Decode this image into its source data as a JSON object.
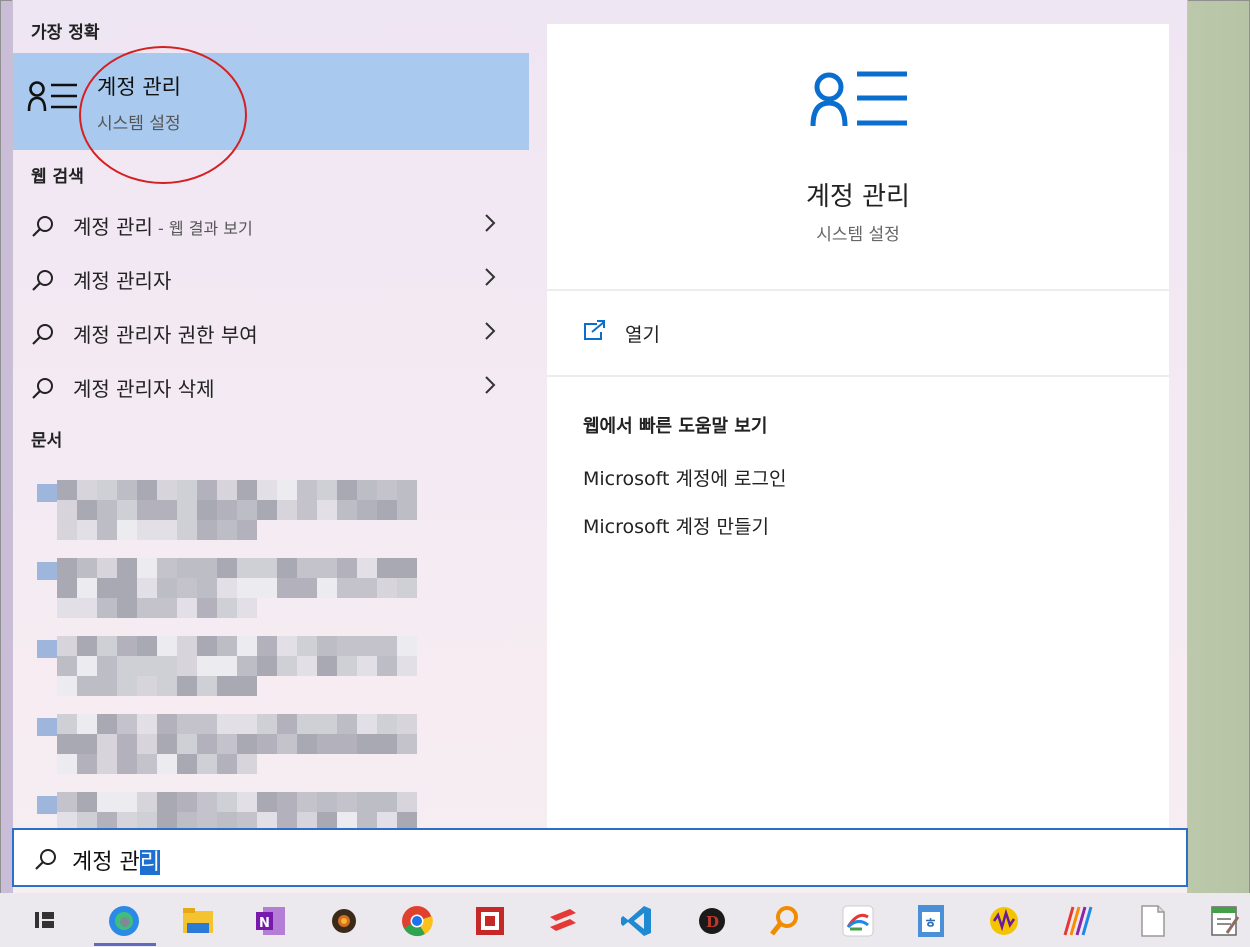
{
  "sections": {
    "best_match": "가장 정확",
    "web_search": "웹 검색",
    "documents": "문서"
  },
  "best_match_item": {
    "title": "계정 관리",
    "subtitle": "시스템 설정"
  },
  "web_results": [
    {
      "label": "계정 관리",
      "suffix": " - 웹 결과 보기"
    },
    {
      "label": "계정 관리자",
      "suffix": ""
    },
    {
      "label": "계정 관리자 권한 부여",
      "suffix": ""
    },
    {
      "label": "계정 관리자 삭제",
      "suffix": ""
    }
  ],
  "preview": {
    "title": "계정 관리",
    "subtitle": "시스템 설정",
    "open_label": "열기",
    "help_heading": "웹에서 빠른 도움말 보기",
    "help_links": [
      "Microsoft 계정에 로그인",
      "Microsoft 계정 만들기"
    ]
  },
  "search": {
    "prefix": "계정 관",
    "selected": "리"
  },
  "taskbar_icons": [
    "task-view-icon",
    "edge-icon",
    "file-explorer-icon",
    "onenote-icon",
    "game-icon",
    "chrome-icon",
    "app-red-icon",
    "express-icon",
    "vscode-icon",
    "diablo-icon",
    "magnifier-icon",
    "app-flower-icon",
    "hwp-icon",
    "audio-app-icon",
    "app-lines-icon",
    "notepad-icon",
    "editor-icon"
  ],
  "colors": {
    "accent": "#0a6ecf",
    "highlight": "#a9c9ee",
    "annotation": "#d42020"
  }
}
